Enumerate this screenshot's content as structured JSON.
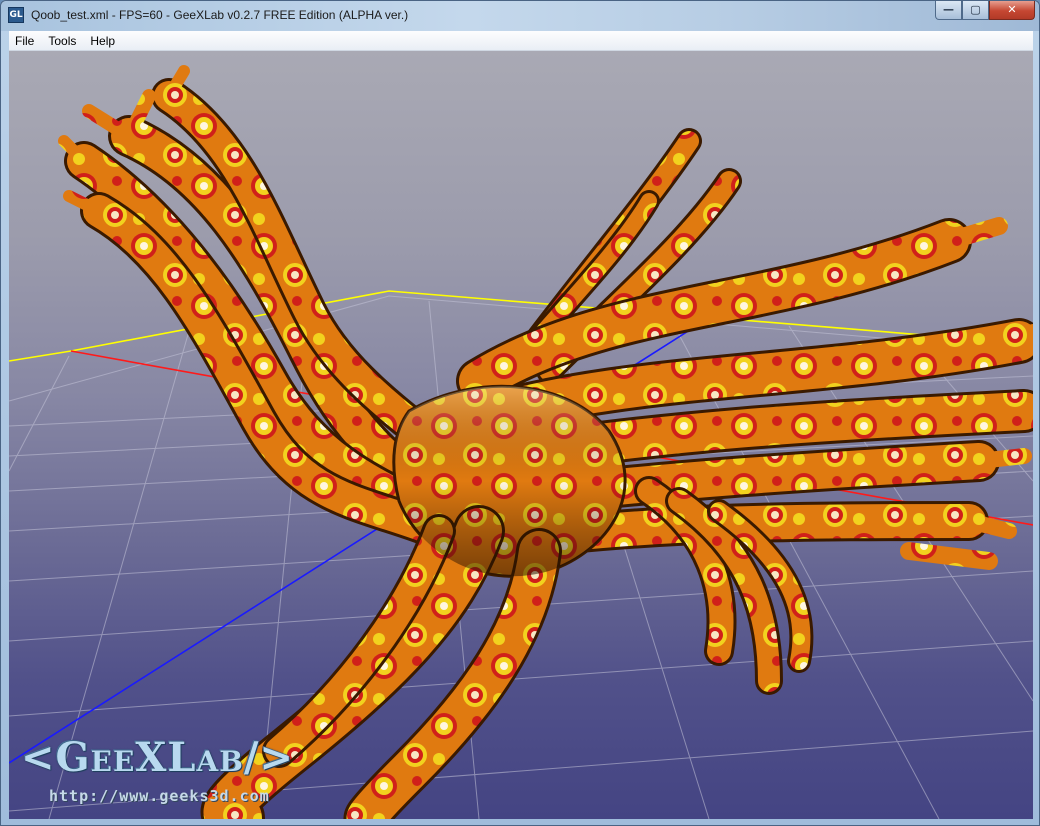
{
  "window": {
    "app_icon_text": "GL",
    "title": "Qoob_test.xml - FPS=60 - GeeXLab v0.2.7 FREE Edition (ALPHA ver.)",
    "minimize_glyph": "—",
    "maximize_glyph": "▢",
    "close_glyph": "✕"
  },
  "menu": {
    "items": [
      "File",
      "Tools",
      "Help"
    ]
  },
  "viewport": {
    "logo_text": "<GeeXLab/>",
    "logo_url": "http://www.geeks3d.com",
    "colors": {
      "axis_x": "#ff1a1a",
      "axis_y": "#ffff00",
      "axis_z": "#1a1aff",
      "grid": "#c4c4d8",
      "tentacle_base": "#e07a10",
      "tentacle_pattern_red": "#d0201a",
      "tentacle_pattern_yellow": "#f2d21e"
    }
  }
}
